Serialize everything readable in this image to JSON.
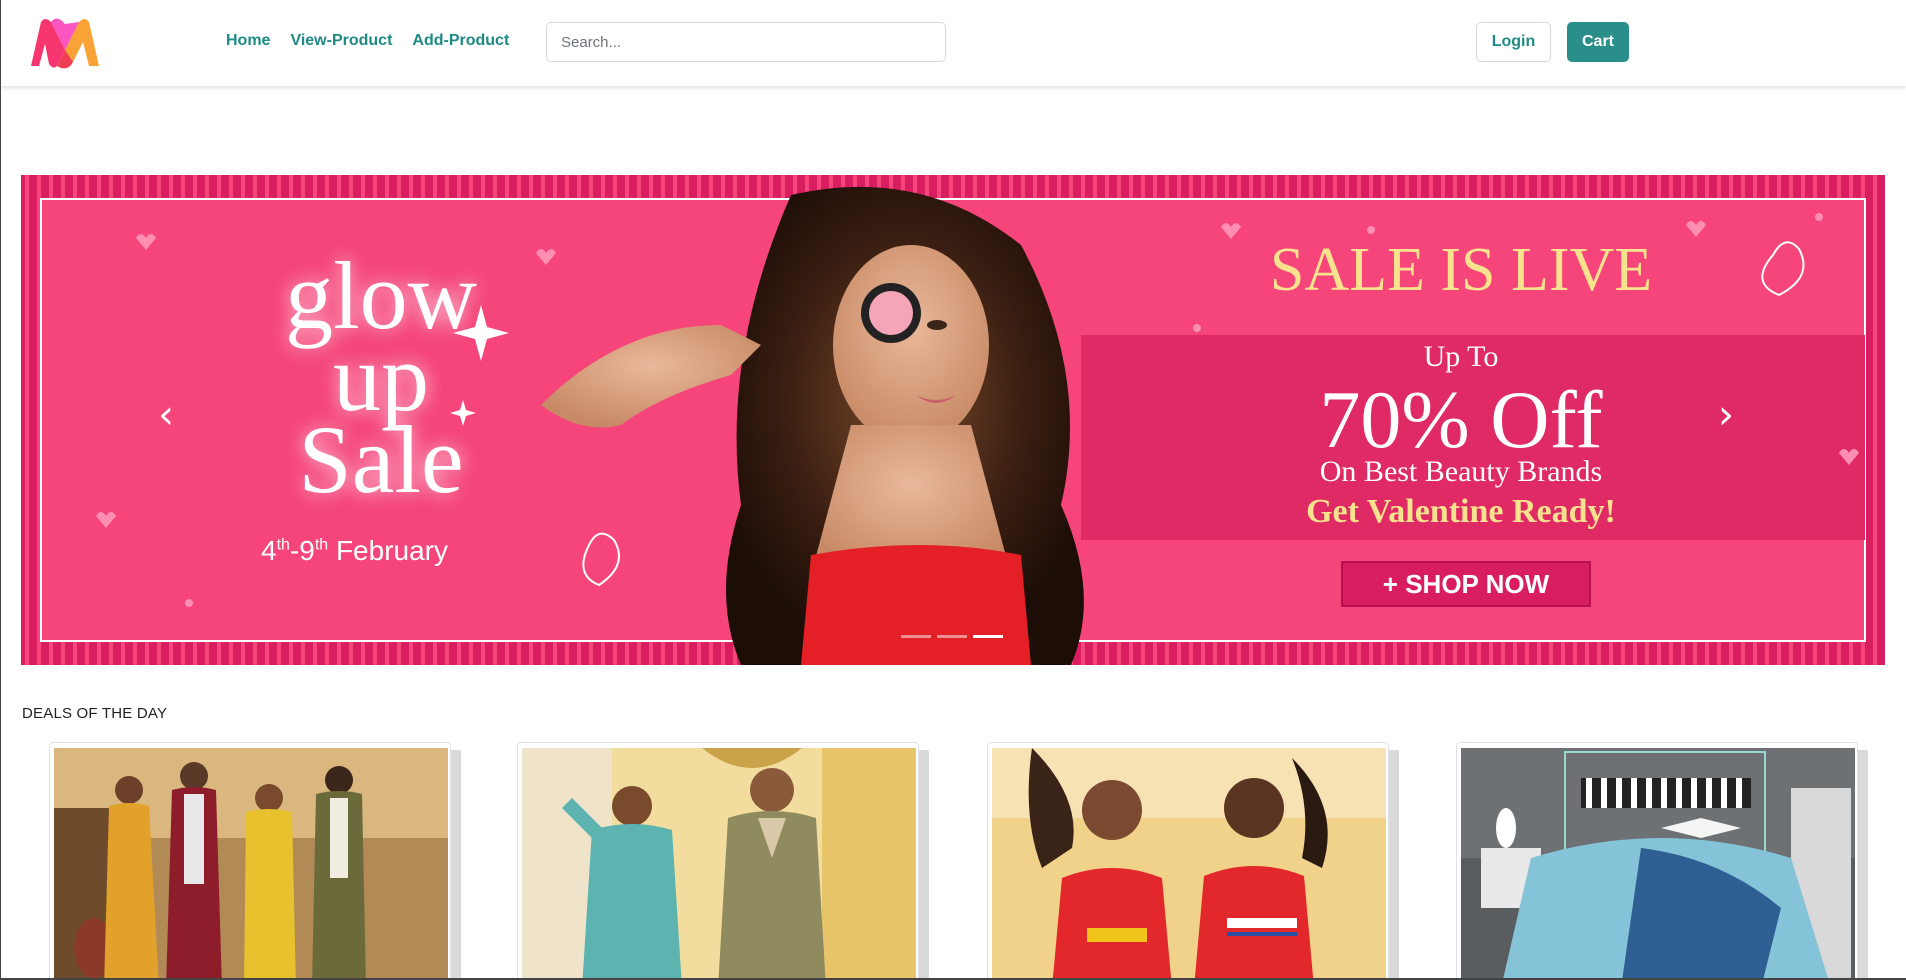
{
  "navbar": {
    "logo_icon": "myntra-m-logo-icon",
    "links": [
      {
        "label": "Home"
      },
      {
        "label": "View-Product"
      },
      {
        "label": "Add-Product"
      }
    ],
    "search": {
      "placeholder": "Search...",
      "value": ""
    },
    "login_label": "Login",
    "cart_label": "Cart"
  },
  "banner": {
    "glow_line1": "glow",
    "glow_line2": "up",
    "glow_line3": "Sale",
    "date_start": "4",
    "date_start_sup": "th",
    "date_end": "-9",
    "date_end_sup": "th",
    "date_month": " February",
    "sale_live": "SALE IS LIVE",
    "up_to": "Up To",
    "off": "70% Off",
    "beauty": "On Best Beauty Brands",
    "valentine": "Get Valentine Ready!",
    "shop_now": "+ SHOP NOW",
    "prev_icon": "chevron-left-icon",
    "next_icon": "chevron-right-icon",
    "slide_count": 3,
    "active_slide": 3
  },
  "deals": {
    "title": "DEALS OF THE DAY",
    "cards": [
      {
        "image": "family-ethnic-wear-photo"
      },
      {
        "image": "men-casual-wear-photo"
      },
      {
        "image": "women-tshirts-photo"
      },
      {
        "image": "bedroom-bedding-photo"
      }
    ]
  },
  "colors": {
    "brand_teal": "#2a8f8a",
    "banner_pink": "#f5457a",
    "banner_border": "#d91d61",
    "gold_text": "#f8e28d"
  }
}
